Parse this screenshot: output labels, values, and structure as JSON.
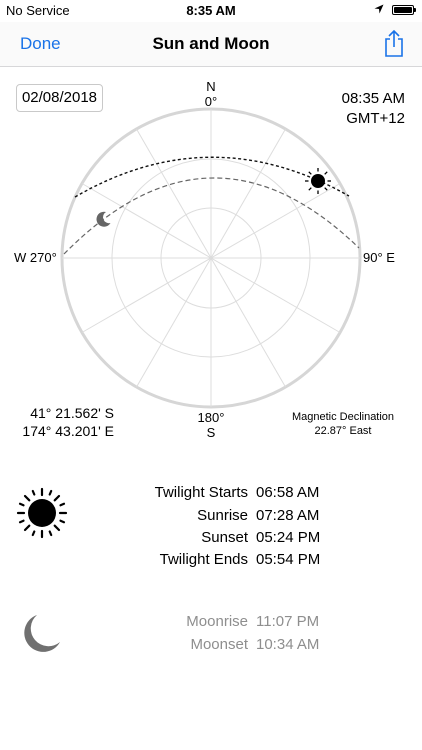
{
  "status_bar": {
    "carrier": "No Service",
    "time": "8:35 AM"
  },
  "nav": {
    "done_label": "Done",
    "title": "Sun and Moon"
  },
  "date": "02/08/2018",
  "clock": {
    "time": "08:35 AM",
    "timezone": "GMT+12"
  },
  "compass": {
    "north": "N",
    "north_deg": "0°",
    "south_deg": "180°",
    "south": "S",
    "west": "W 270°",
    "east": "90° E"
  },
  "location": {
    "latitude": "41° 21.562' S",
    "longitude": "174° 43.201' E"
  },
  "magnetic_declination": {
    "label": "Magnetic Declination",
    "value": "22.87° East"
  },
  "sun_times": [
    {
      "label": "Twilight Starts",
      "time": "06:58 AM"
    },
    {
      "label": "Sunrise",
      "time": "07:28 AM"
    },
    {
      "label": "Sunset",
      "time": "05:24 PM"
    },
    {
      "label": "Twilight Ends",
      "time": "05:54 PM"
    }
  ],
  "moon_times": [
    {
      "label": "Moonrise",
      "time": "11:07 PM"
    },
    {
      "label": "Moonset",
      "time": "10:34 AM"
    }
  ],
  "icons": {
    "sun": "sun-icon",
    "moon": "moon-icon",
    "share": "share-icon",
    "location": "location-arrow-icon",
    "battery": "battery-icon"
  }
}
